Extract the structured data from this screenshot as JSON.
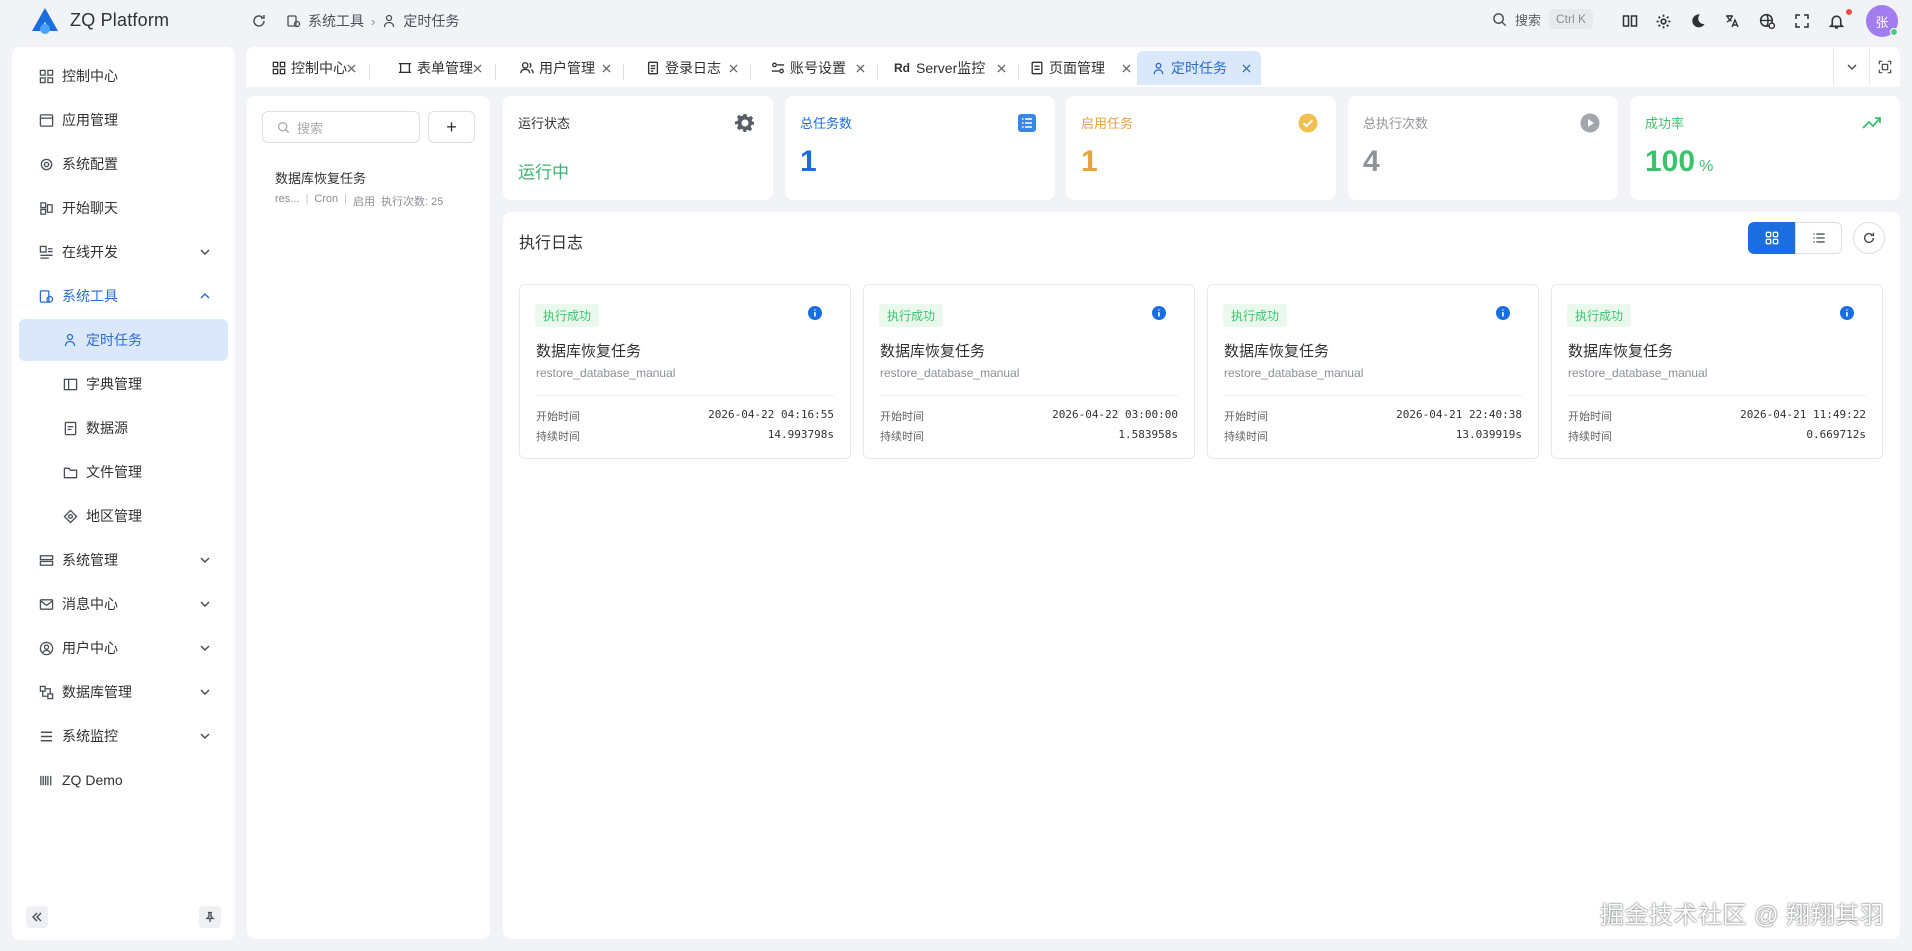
{
  "header": {
    "app_title": "ZQ Platform",
    "breadcrumb": [
      "系统工具",
      "定时任务"
    ],
    "search_label": "搜索",
    "search_shortcut": "Ctrl K",
    "avatar_text": "张"
  },
  "sidebar": {
    "items": [
      {
        "label": "控制中心",
        "icon": "dashboard-icon"
      },
      {
        "label": "应用管理",
        "icon": "app-window-icon"
      },
      {
        "label": "系统配置",
        "icon": "gear-icon"
      },
      {
        "label": "开始聊天",
        "icon": "chat-icon"
      },
      {
        "label": "在线开发",
        "icon": "code-icon",
        "expandable": true
      },
      {
        "label": "系统工具",
        "icon": "toolbox-icon",
        "expanded": true
      },
      {
        "label": "定时任务",
        "icon": "timer-icon",
        "active": true
      },
      {
        "label": "字典管理",
        "icon": "book-icon"
      },
      {
        "label": "数据源",
        "icon": "database-doc-icon"
      },
      {
        "label": "文件管理",
        "icon": "folder-icon"
      },
      {
        "label": "地区管理",
        "icon": "location-icon"
      },
      {
        "label": "系统管理",
        "icon": "settings-grid-icon",
        "expandable": true
      },
      {
        "label": "消息中心",
        "icon": "mail-icon",
        "expandable": true
      },
      {
        "label": "用户中心",
        "icon": "user-circle-icon",
        "expandable": true
      },
      {
        "label": "数据库管理",
        "icon": "db-manage-icon",
        "expandable": true
      },
      {
        "label": "系统监控",
        "icon": "menu-lines-icon",
        "expandable": true
      },
      {
        "label": "ZQ Demo",
        "icon": "barcode-icon"
      }
    ]
  },
  "tabs": [
    {
      "label": "控制中心"
    },
    {
      "label": "表单管理"
    },
    {
      "label": "用户管理"
    },
    {
      "label": "登录日志"
    },
    {
      "label": "账号设置"
    },
    {
      "label": "Server监控",
      "prefix": "Rd"
    },
    {
      "label": "页面管理"
    },
    {
      "label": "定时任务",
      "active": true
    }
  ],
  "task_panel": {
    "search_placeholder": "搜索",
    "add_label": "+",
    "task": {
      "name": "数据库恢复任务",
      "code": "res...",
      "trigger": "Cron",
      "status": "启用",
      "runs": "执行次数: 25"
    }
  },
  "stats": [
    {
      "label": "运行状态",
      "value": "运行中",
      "color": "#3cb371",
      "icon": "gear-icon"
    },
    {
      "label": "总任务数",
      "value": "1",
      "color": "#1a6ee0",
      "icon": "list-icon"
    },
    {
      "label": "启用任务",
      "value": "1",
      "color": "#e6a23c",
      "icon": "check-circle-icon"
    },
    {
      "label": "总执行次数",
      "value": "4",
      "color": "#909399",
      "icon": "play-circle-icon"
    },
    {
      "label": "成功率",
      "value": "100",
      "unit": "%",
      "color": "#3cc16d",
      "icon": "trend-up-icon"
    }
  ],
  "log": {
    "title": "执行日志",
    "start_label": "开始时间",
    "duration_label": "持续时间",
    "cards": [
      {
        "status": "执行成功",
        "name": "数据库恢复任务",
        "code": "restore_database_manual",
        "start": "2026-04-22 04:16:55",
        "duration": "14.993798s"
      },
      {
        "status": "执行成功",
        "name": "数据库恢复任务",
        "code": "restore_database_manual",
        "start": "2026-04-22 03:00:00",
        "duration": "1.583958s"
      },
      {
        "status": "执行成功",
        "name": "数据库恢复任务",
        "code": "restore_database_manual",
        "start": "2026-04-21 22:40:38",
        "duration": "13.039919s"
      },
      {
        "status": "执行成功",
        "name": "数据库恢复任务",
        "code": "restore_database_manual",
        "start": "2026-04-21 11:49:22",
        "duration": "0.669712s"
      }
    ]
  },
  "watermark": "掘金技术社区 @ 翔翔其羽",
  "colors": {
    "accent": "#1a6ee0",
    "active_bg": "#dbe7fa",
    "success": "#3cc16d"
  }
}
